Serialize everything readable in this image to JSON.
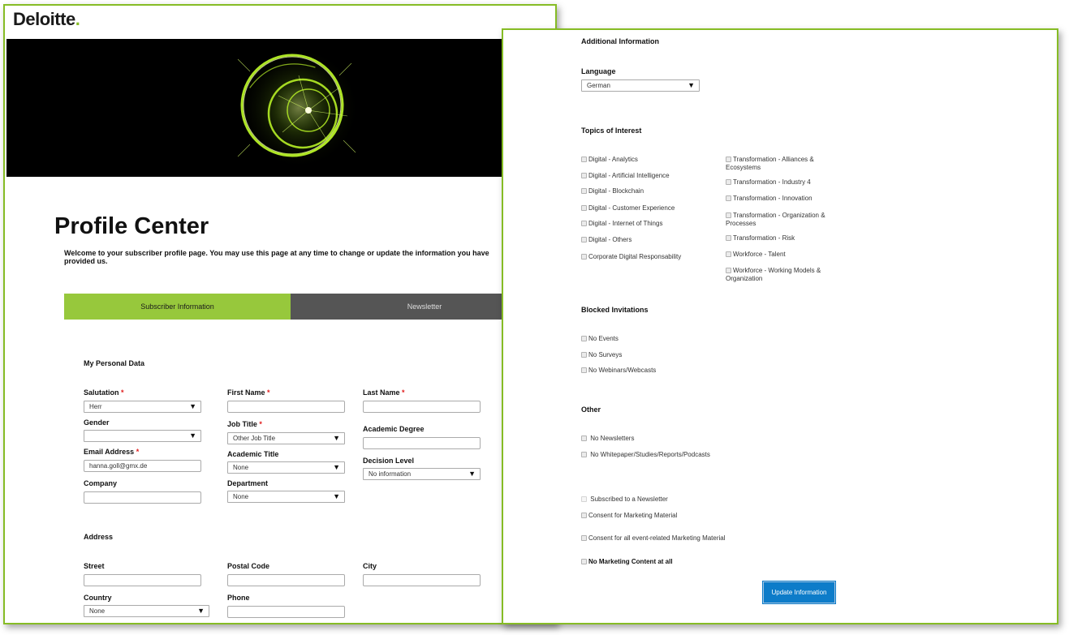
{
  "brand": {
    "name": "Deloitte",
    "dot": ".",
    "accent": "#86bc25"
  },
  "page": {
    "title": "Profile Center",
    "intro": "Welcome to your subscriber profile page. You may use this page at any time to change or update the information you have provided us."
  },
  "tabs": [
    {
      "label": "Subscriber Information",
      "active": true
    },
    {
      "label": "Newsletter",
      "active": false
    }
  ],
  "personal": {
    "heading": "My Personal Data",
    "required_mark": "*",
    "salutation": {
      "label": "Salutation",
      "value": "Herr"
    },
    "first_name": {
      "label": "First Name",
      "value": ""
    },
    "last_name": {
      "label": "Last Name",
      "value": ""
    },
    "gender": {
      "label": "Gender",
      "value": ""
    },
    "job_title": {
      "label": "Job Title",
      "value": "Other Job Title"
    },
    "academic_degree": {
      "label": "Academic Degree",
      "value": ""
    },
    "email": {
      "label": "Email Address",
      "value": "hanna.goll@gmx.de"
    },
    "academic_title": {
      "label": "Academic Title",
      "value": "None"
    },
    "decision_level": {
      "label": "Decision Level",
      "value": "No information"
    },
    "company": {
      "label": "Company",
      "value": ""
    },
    "department": {
      "label": "Department",
      "value": "None"
    }
  },
  "address": {
    "heading": "Address",
    "street": {
      "label": "Street",
      "value": ""
    },
    "postal_code": {
      "label": "Postal Code",
      "value": ""
    },
    "city": {
      "label": "City",
      "value": ""
    },
    "country": {
      "label": "Country",
      "value": "None"
    },
    "phone": {
      "label": "Phone",
      "value": ""
    }
  },
  "additional": {
    "heading": "Additional Information",
    "language": {
      "label": "Language",
      "value": "German"
    }
  },
  "topics": {
    "heading": "Topics of Interest",
    "left": [
      "Digital - Analytics",
      "Digital - Artificial Intelligence",
      "Digital - Blockchain",
      "Digital - Customer Experience",
      "Digital - Internet of Things",
      "Digital - Others",
      "Corporate Digital Responsability"
    ],
    "right": [
      "Transformation - Alliances & Ecosystems",
      "Transformation - Industry 4",
      "Transformation - Innovation",
      "Transformation - Organization & Processes",
      "Transformation - Risk",
      "Workforce - Talent",
      "Workforce - Working Models & Organization"
    ]
  },
  "blocked": {
    "heading": "Blocked Invitations",
    "items": [
      "No Events",
      "No Surveys",
      "No Webinars/Webcasts"
    ]
  },
  "other": {
    "heading": "Other",
    "items": [
      "No Newsletters",
      "No Whitepaper/Studies/Reports/Podcasts"
    ]
  },
  "consent": {
    "subscribed": "Subscribed to a Newsletter",
    "marketing": "Consent for Marketing Material",
    "event_marketing": "Consent for all event-related Marketing Material",
    "no_marketing": "No Marketing Content at all"
  },
  "actions": {
    "update_label": "Update Information"
  },
  "icons": {
    "dropdown_arrow": "▼",
    "checkbox": "checkbox-icon"
  }
}
